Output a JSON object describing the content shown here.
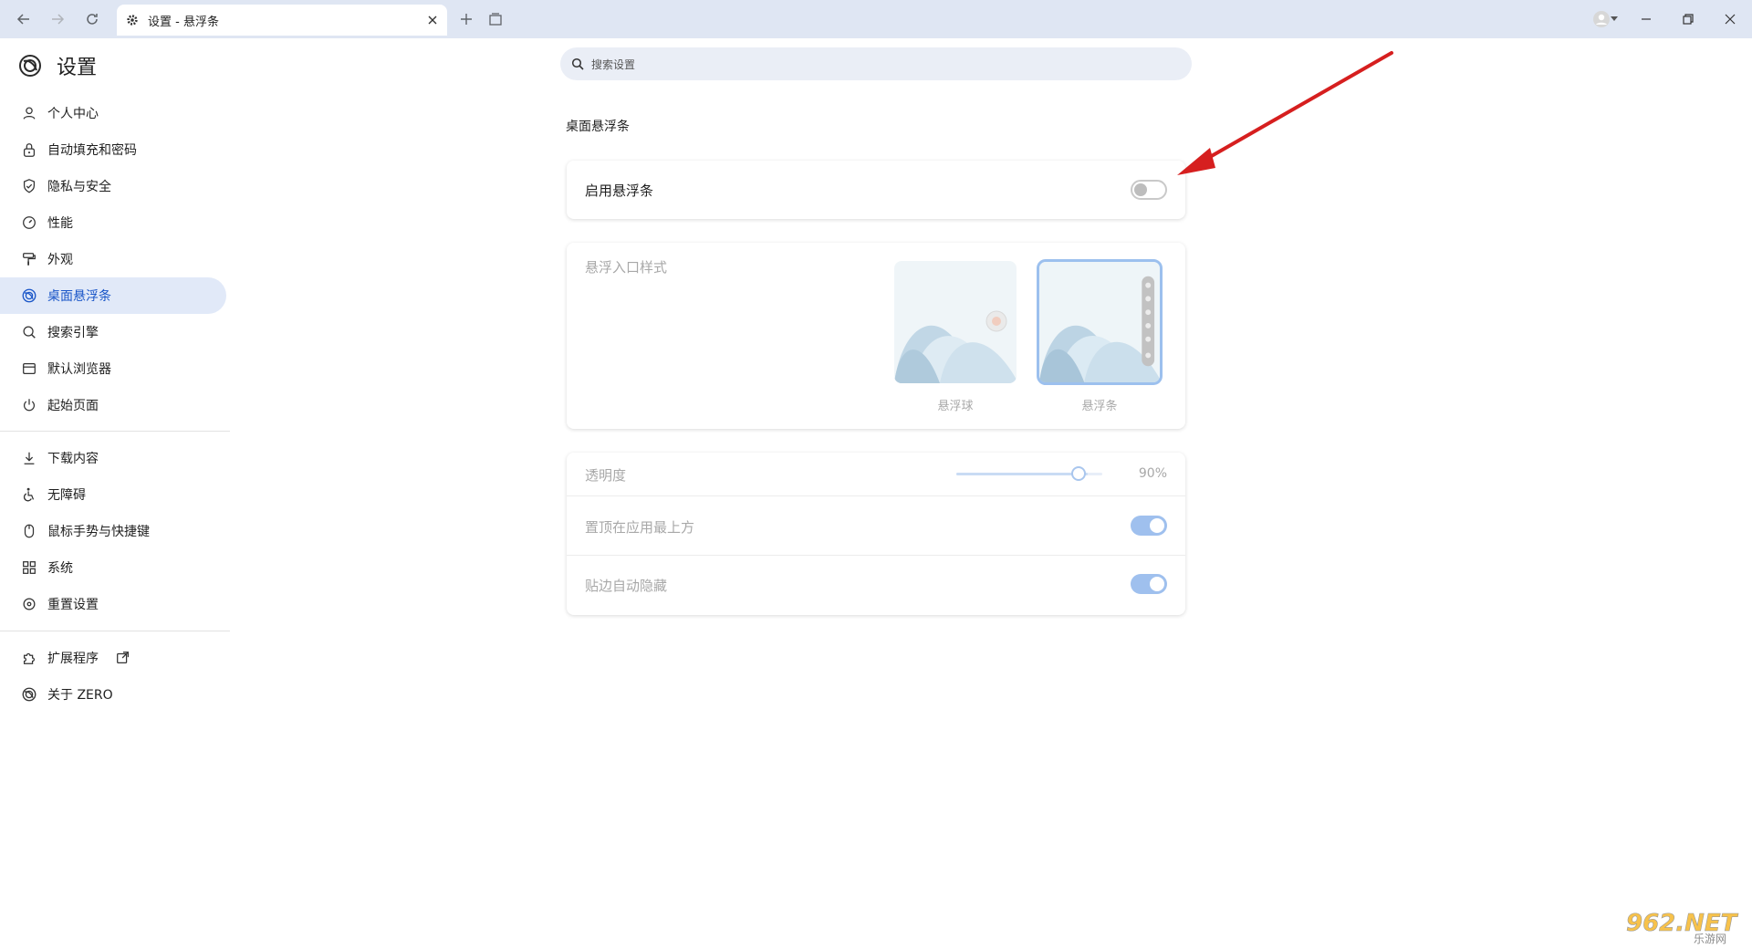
{
  "browser": {
    "tab_title": "设置 - 悬浮条"
  },
  "settings": {
    "title": "设置",
    "search_placeholder": "搜索设置",
    "nav_group1": [
      {
        "label": "个人中心",
        "icon": "person-icon"
      },
      {
        "label": "自动填充和密码",
        "icon": "lock-icon"
      },
      {
        "label": "隐私与安全",
        "icon": "shield-icon"
      },
      {
        "label": "性能",
        "icon": "gauge-icon"
      },
      {
        "label": "外观",
        "icon": "paint-roller-icon"
      },
      {
        "label": "桌面悬浮条",
        "icon": "zero-logo-icon",
        "active": true
      },
      {
        "label": "搜索引擎",
        "icon": "search-icon"
      },
      {
        "label": "默认浏览器",
        "icon": "browser-icon"
      },
      {
        "label": "起始页面",
        "icon": "power-icon"
      }
    ],
    "nav_group2": [
      {
        "label": "下载内容",
        "icon": "download-icon"
      },
      {
        "label": "无障碍",
        "icon": "accessibility-icon"
      },
      {
        "label": "鼠标手势与快捷键",
        "icon": "mouse-icon"
      },
      {
        "label": "系统",
        "icon": "grid-icon"
      },
      {
        "label": "重置设置",
        "icon": "reset-icon"
      }
    ],
    "nav_group3": [
      {
        "label": "扩展程序",
        "icon": "puzzle-icon"
      },
      {
        "label": "关于 ZERO",
        "icon": "zero-logo-icon"
      }
    ]
  },
  "content": {
    "section_title": "桌面悬浮条",
    "enable_label": "启用悬浮条",
    "enable_on": false,
    "style_label": "悬浮入口样式",
    "style_options": [
      {
        "label": "悬浮球",
        "selected": false
      },
      {
        "label": "悬浮条",
        "selected": true
      }
    ],
    "opacity_label": "透明度",
    "opacity_value": "90%",
    "opacity_fraction": 0.9,
    "pin_top_label": "置顶在应用最上方",
    "pin_top_on": true,
    "auto_hide_label": "贴边自动隐藏",
    "auto_hide_on": true
  },
  "watermark": {
    "main": "962.NET",
    "sub": "乐游网"
  },
  "colors": {
    "accent": "#1a56c8",
    "active_bg": "#e1e9f8",
    "titlebar": "#dfe6f3",
    "annotation_arrow": "#d61f1f"
  }
}
